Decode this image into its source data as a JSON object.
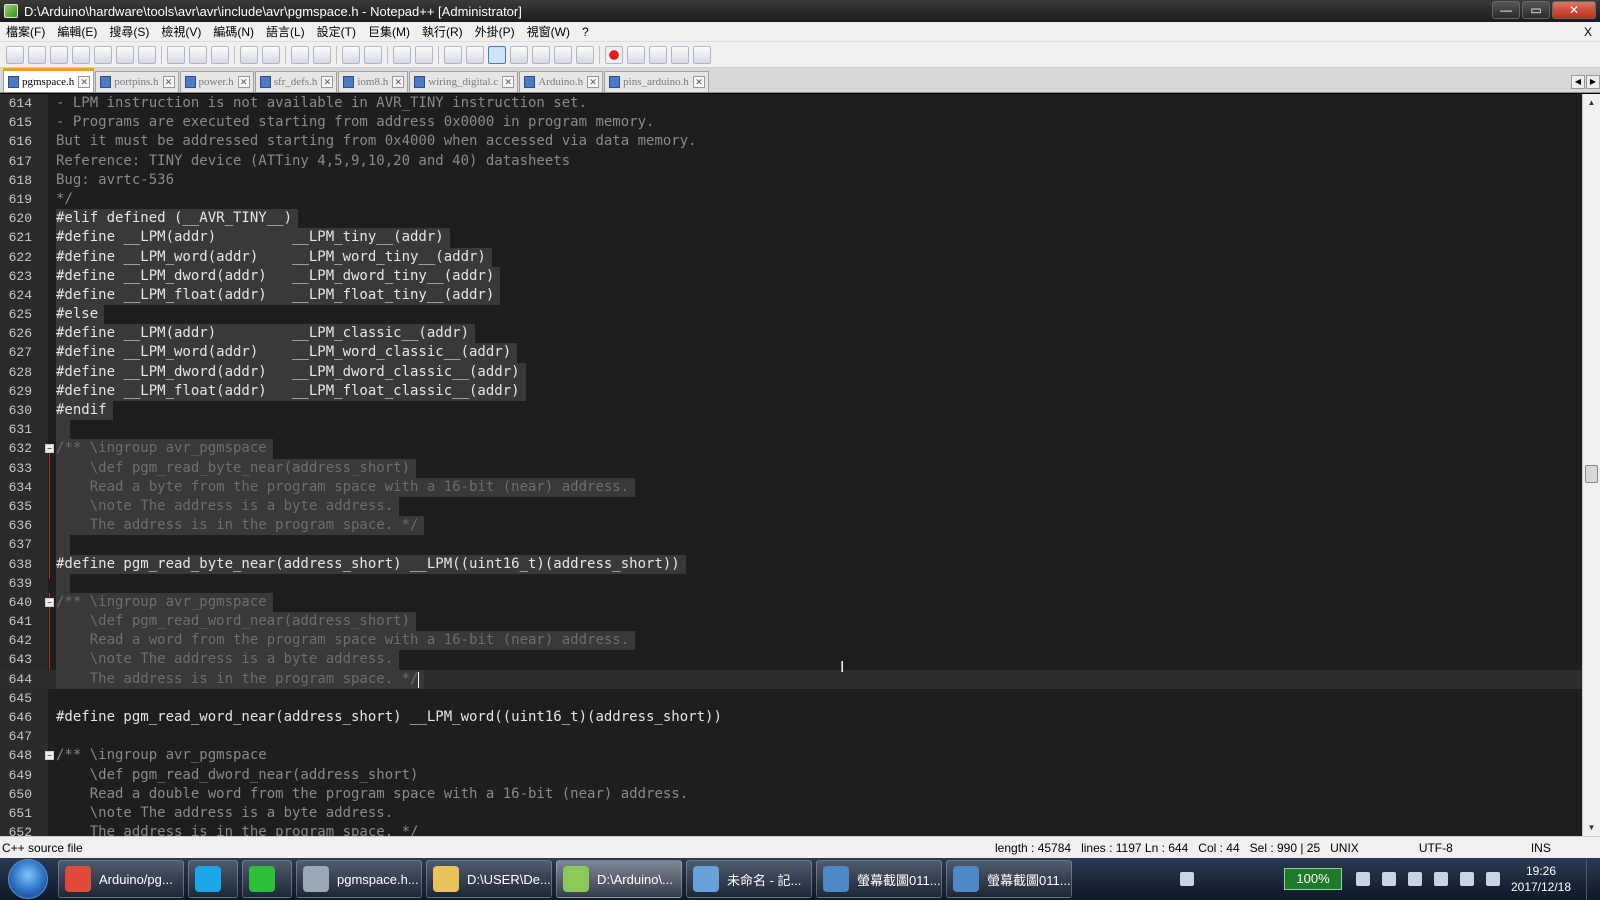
{
  "window": {
    "title": "D:\\Arduino\\hardware\\tools\\avr\\avr\\include\\avr\\pgmspace.h - Notepad++ [Administrator]",
    "minimize": "—",
    "maximize": "▭",
    "close": "✕"
  },
  "menu": {
    "items": [
      "檔案(F)",
      "編輯(E)",
      "搜尋(S)",
      "檢視(V)",
      "編碼(N)",
      "語言(L)",
      "設定(T)",
      "巨集(M)",
      "執行(R)",
      "外掛(P)",
      "視窗(W)",
      "?"
    ],
    "close": "X"
  },
  "tabs": [
    {
      "label": "pgmspace.h",
      "active": true
    },
    {
      "label": "portpins.h",
      "active": false
    },
    {
      "label": "power.h",
      "active": false
    },
    {
      "label": "sfr_defs.h",
      "active": false
    },
    {
      "label": "iom8.h",
      "active": false
    },
    {
      "label": "wiring_digital.c",
      "active": false
    },
    {
      "label": "Arduino.h",
      "active": false
    },
    {
      "label": "pins_arduino.h",
      "active": false
    }
  ],
  "tab_nav": {
    "prev": "◀",
    "next": "▶"
  },
  "editor": {
    "lines": [
      {
        "n": "614",
        "text": "- LPM instruction is not available in AVR_TINY instruction set.",
        "kind": "comment"
      },
      {
        "n": "615",
        "text": "- Programs are executed starting from address 0x0000 in program memory.",
        "kind": "comment"
      },
      {
        "n": "616",
        "text": "But it must be addressed starting from 0x4000 when accessed via data memory.",
        "kind": "comment"
      },
      {
        "n": "617",
        "text": "Reference: TINY device (ATTiny 4,5,9,10,20 and 40) datasheets",
        "kind": "comment"
      },
      {
        "n": "618",
        "text": "Bug: avrtc-536",
        "kind": "comment"
      },
      {
        "n": "619",
        "text": "*/",
        "kind": "comment"
      },
      {
        "n": "620",
        "text": "#elif defined (__AVR_TINY__)",
        "kind": "pre",
        "sel": true
      },
      {
        "n": "621",
        "text": "#define __LPM(addr)         __LPM_tiny__(addr)",
        "kind": "pre",
        "sel": true
      },
      {
        "n": "622",
        "text": "#define __LPM_word(addr)    __LPM_word_tiny__(addr)",
        "kind": "pre",
        "sel": true
      },
      {
        "n": "623",
        "text": "#define __LPM_dword(addr)   __LPM_dword_tiny__(addr)",
        "kind": "pre",
        "sel": true
      },
      {
        "n": "624",
        "text": "#define __LPM_float(addr)   __LPM_float_tiny__(addr)",
        "kind": "pre",
        "sel": true
      },
      {
        "n": "625",
        "text": "#else",
        "kind": "pre",
        "sel": true
      },
      {
        "n": "626",
        "text": "#define __LPM(addr)         __LPM_classic__(addr)",
        "kind": "pre",
        "sel": true
      },
      {
        "n": "627",
        "text": "#define __LPM_word(addr)    __LPM_word_classic__(addr)",
        "kind": "pre",
        "sel": true
      },
      {
        "n": "628",
        "text": "#define __LPM_dword(addr)   __LPM_dword_classic__(addr)",
        "kind": "pre",
        "sel": true
      },
      {
        "n": "629",
        "text": "#define __LPM_float(addr)   __LPM_float_classic__(addr)",
        "kind": "pre",
        "sel": true
      },
      {
        "n": "630",
        "text": "#endif",
        "kind": "pre",
        "sel": true
      },
      {
        "n": "631",
        "text": " ",
        "kind": "pre",
        "sel": true
      },
      {
        "n": "632",
        "text": "/** \\ingroup avr_pgmspace",
        "kind": "selcomment",
        "sel": true,
        "fold": "−"
      },
      {
        "n": "633",
        "text": "    \\def pgm_read_byte_near(address_short)",
        "kind": "selcomment",
        "sel": true
      },
      {
        "n": "634",
        "text": "    Read a byte from the program space with a 16-bit (near) address.",
        "kind": "selcomment",
        "sel": true
      },
      {
        "n": "635",
        "text": "    \\note The address is a byte address.",
        "kind": "selcomment",
        "sel": true
      },
      {
        "n": "636",
        "text": "    The address is in the program space. */",
        "kind": "selcomment",
        "sel": true
      },
      {
        "n": "637",
        "text": " ",
        "kind": "pre",
        "sel": true
      },
      {
        "n": "638",
        "text": "#define pgm_read_byte_near(address_short) __LPM((uint16_t)(address_short))",
        "kind": "pre",
        "sel": true
      },
      {
        "n": "639",
        "text": " ",
        "kind": "pre",
        "sel": true
      },
      {
        "n": "640",
        "text": "/** \\ingroup avr_pgmspace",
        "kind": "selcomment",
        "sel": true,
        "fold": "−"
      },
      {
        "n": "641",
        "text": "    \\def pgm_read_word_near(address_short)",
        "kind": "selcomment",
        "sel": true
      },
      {
        "n": "642",
        "text": "    Read a word from the program space with a 16-bit (near) address.",
        "kind": "selcomment",
        "sel": true
      },
      {
        "n": "643",
        "text": "    \\note The address is a byte address.",
        "kind": "selcomment",
        "sel": true
      },
      {
        "n": "644",
        "text": "    The address is in the program space. */",
        "kind": "selcomment",
        "sel": true,
        "current": true
      },
      {
        "n": "645",
        "text": "",
        "kind": "pre"
      },
      {
        "n": "646",
        "text": "#define pgm_read_word_near(address_short) __LPM_word((uint16_t)(address_short))",
        "kind": "pre"
      },
      {
        "n": "647",
        "text": "",
        "kind": "pre"
      },
      {
        "n": "648",
        "text": "/** \\ingroup avr_pgmspace",
        "kind": "comment",
        "fold": "−"
      },
      {
        "n": "649",
        "text": "    \\def pgm_read_dword_near(address_short)",
        "kind": "comment"
      },
      {
        "n": "650",
        "text": "    Read a double word from the program space with a 16-bit (near) address.",
        "kind": "comment"
      },
      {
        "n": "651",
        "text": "    \\note The address is a byte address.",
        "kind": "comment"
      },
      {
        "n": "652",
        "text": "    The address is in the program space. */",
        "kind": "comment"
      }
    ]
  },
  "scrollbar": {
    "up": "▲",
    "down": "▼"
  },
  "statusbar": {
    "file_type": "C++ source file",
    "length": "length : 45784",
    "lines_ln": "lines : 1197   Ln : 644",
    "col": "Col : 44",
    "sel": "Sel : 990 | 25",
    "eol": "UNIX",
    "encoding": "UTF-8",
    "mode": "INS"
  },
  "taskbar": {
    "buttons": [
      {
        "label": "Arduino/pg...",
        "icon": "chrome-icon",
        "color": "#e04a3a"
      },
      {
        "label": "",
        "icon": "kkbox-icon",
        "color": "#1aa6e8"
      },
      {
        "label": "",
        "icon": "line-icon",
        "color": "#2bbf3a"
      },
      {
        "label": "pgmspace.h...",
        "icon": "search-icon",
        "color": "#9aa8b8"
      },
      {
        "label": "D:\\USER\\De...",
        "icon": "folder-icon",
        "color": "#e8c35a"
      },
      {
        "label": "D:\\Arduino\\...",
        "icon": "notepadpp-icon",
        "color": "#8cc85a",
        "active": true
      },
      {
        "label": "未命名 - 記...",
        "icon": "notepad-icon",
        "color": "#6aa0d8"
      },
      {
        "label": "螢幕截圖011...",
        "icon": "image-icon",
        "color": "#4f86c6"
      },
      {
        "label": "螢幕截圖011...",
        "icon": "image-icon",
        "color": "#4f86c6"
      }
    ],
    "battery": "100%",
    "time": "19:26",
    "date": "2017/12/18"
  }
}
